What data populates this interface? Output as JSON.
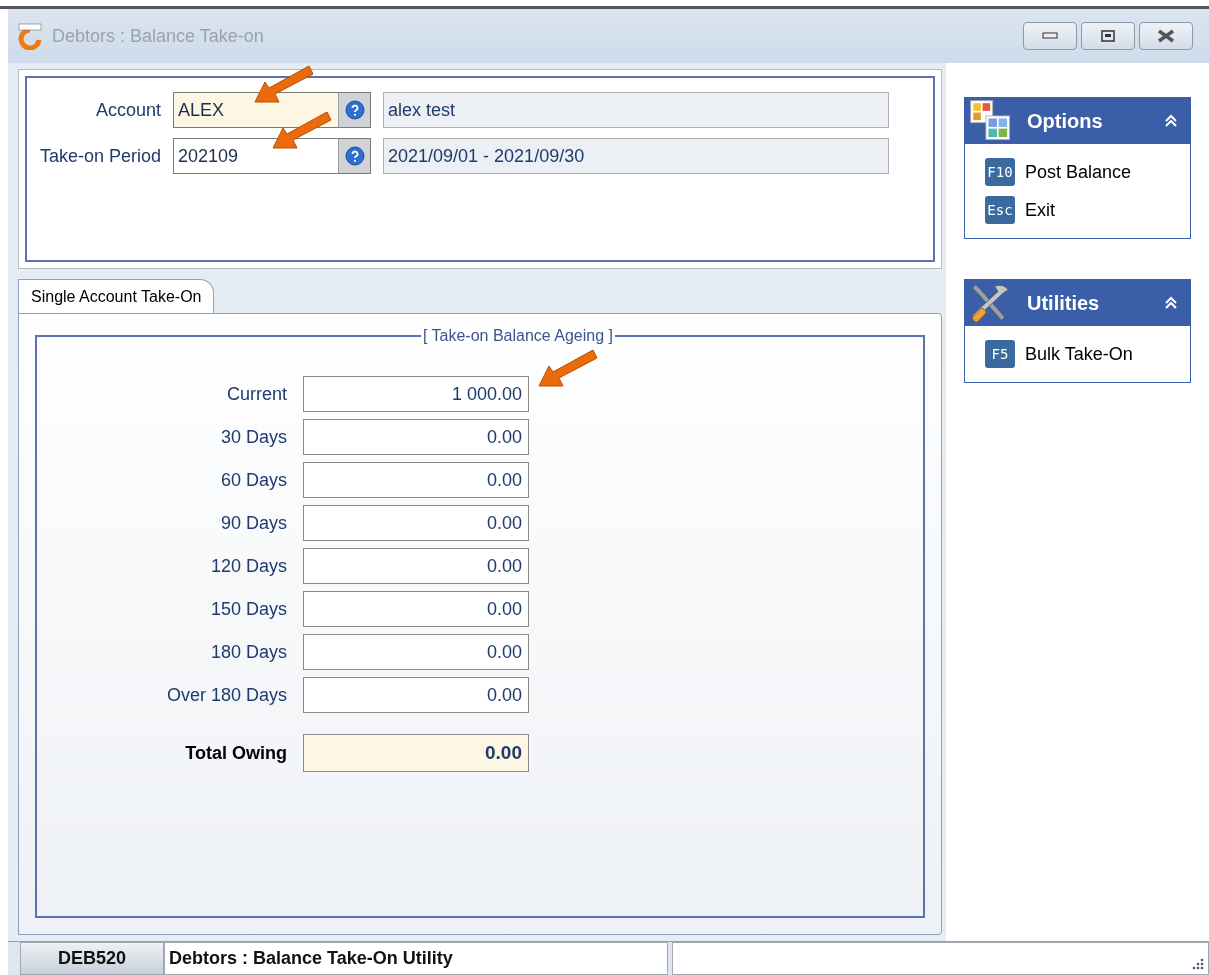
{
  "window": {
    "title": "Debtors : Balance Take-on"
  },
  "header": {
    "fields": [
      {
        "label": "Account",
        "value": "ALEX",
        "highlighted": true,
        "description": "alex test"
      },
      {
        "label": "Take-on Period",
        "value": "202109",
        "highlighted": false,
        "description": "2021/09/01 - 2021/09/30"
      }
    ]
  },
  "tabs": [
    {
      "label": "Single Account Take-On",
      "selected": true
    }
  ],
  "ageing": {
    "title": "[ Take-on Balance Ageing ]",
    "rows": [
      {
        "label": "Current",
        "value": "1 000.00"
      },
      {
        "label": "30 Days",
        "value": "0.00"
      },
      {
        "label": "60 Days",
        "value": "0.00"
      },
      {
        "label": "90 Days",
        "value": "0.00"
      },
      {
        "label": "120 Days",
        "value": "0.00"
      },
      {
        "label": "150 Days",
        "value": "0.00"
      },
      {
        "label": "180 Days",
        "value": "0.00"
      },
      {
        "label": "Over 180 Days",
        "value": "0.00"
      }
    ],
    "total": {
      "label": "Total Owing",
      "value": "0.00"
    }
  },
  "side_panels": [
    {
      "kind": "options",
      "title": "Options",
      "expanded": true,
      "items": [
        {
          "key": "F10",
          "label": "Post Balance"
        },
        {
          "key": "Esc",
          "label": "Exit"
        }
      ]
    },
    {
      "kind": "tools",
      "title": "Utilities",
      "expanded": true,
      "items": [
        {
          "key": "F5",
          "label": "Bulk Take-On"
        }
      ]
    }
  ],
  "status_bar": {
    "code": "DEB520",
    "description": "Debtors : Balance Take-On Utility"
  }
}
